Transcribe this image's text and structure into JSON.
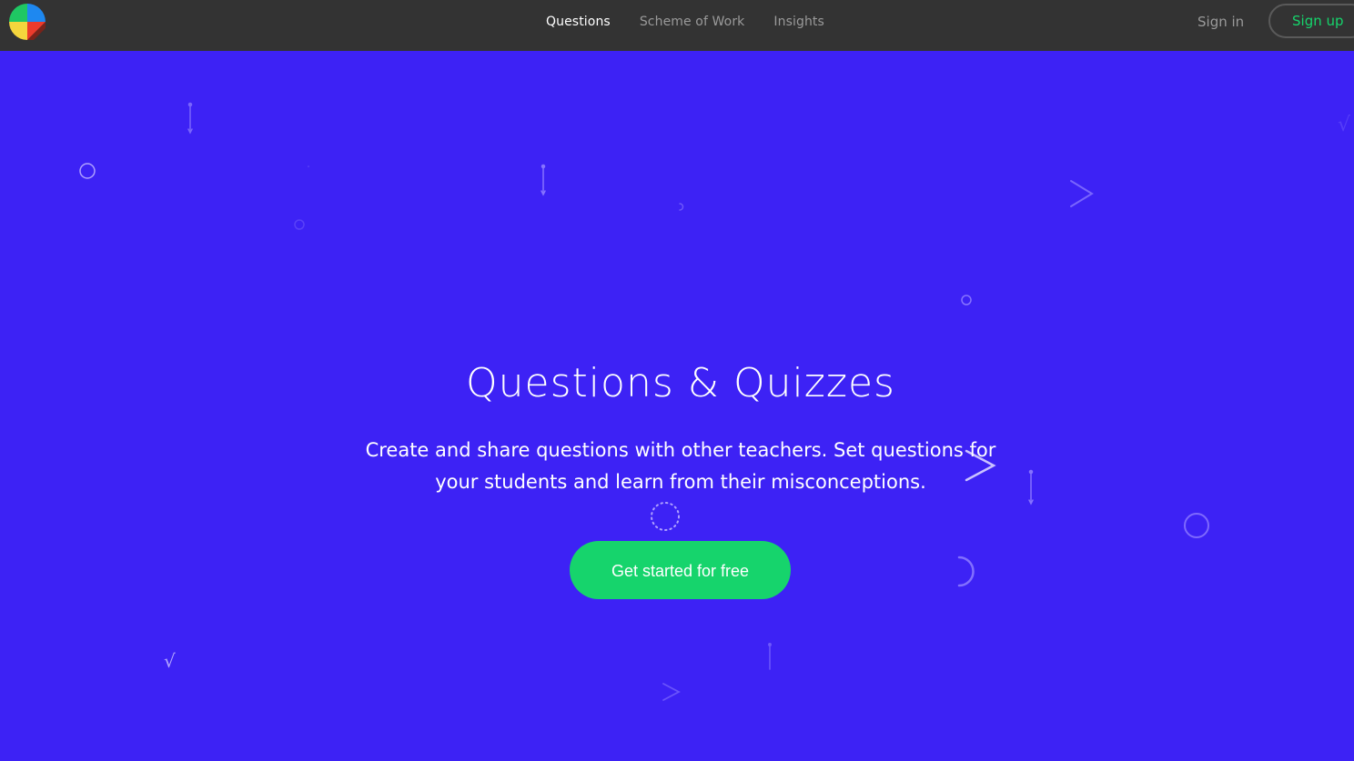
{
  "nav": {
    "links": [
      {
        "label": "Questions"
      },
      {
        "label": "Scheme of Work"
      },
      {
        "label": "Insights"
      }
    ],
    "sign_in": "Sign in",
    "sign_up": "Sign up"
  },
  "hero": {
    "title": "Questions & Quizzes",
    "subtitle": "Create and share questions with other teachers. Set questions for your students and learn from their misconceptions.",
    "cta_label": "Get started for free"
  },
  "symbols": {
    "sqrt": "√",
    "greater_than": ">"
  },
  "colors": {
    "navbar": "#333333",
    "hero_background": "#3d22f5",
    "accent_green": "#16d46c",
    "nav_inactive": "#9a9a9a"
  },
  "icons": [
    "logo-icon"
  ]
}
